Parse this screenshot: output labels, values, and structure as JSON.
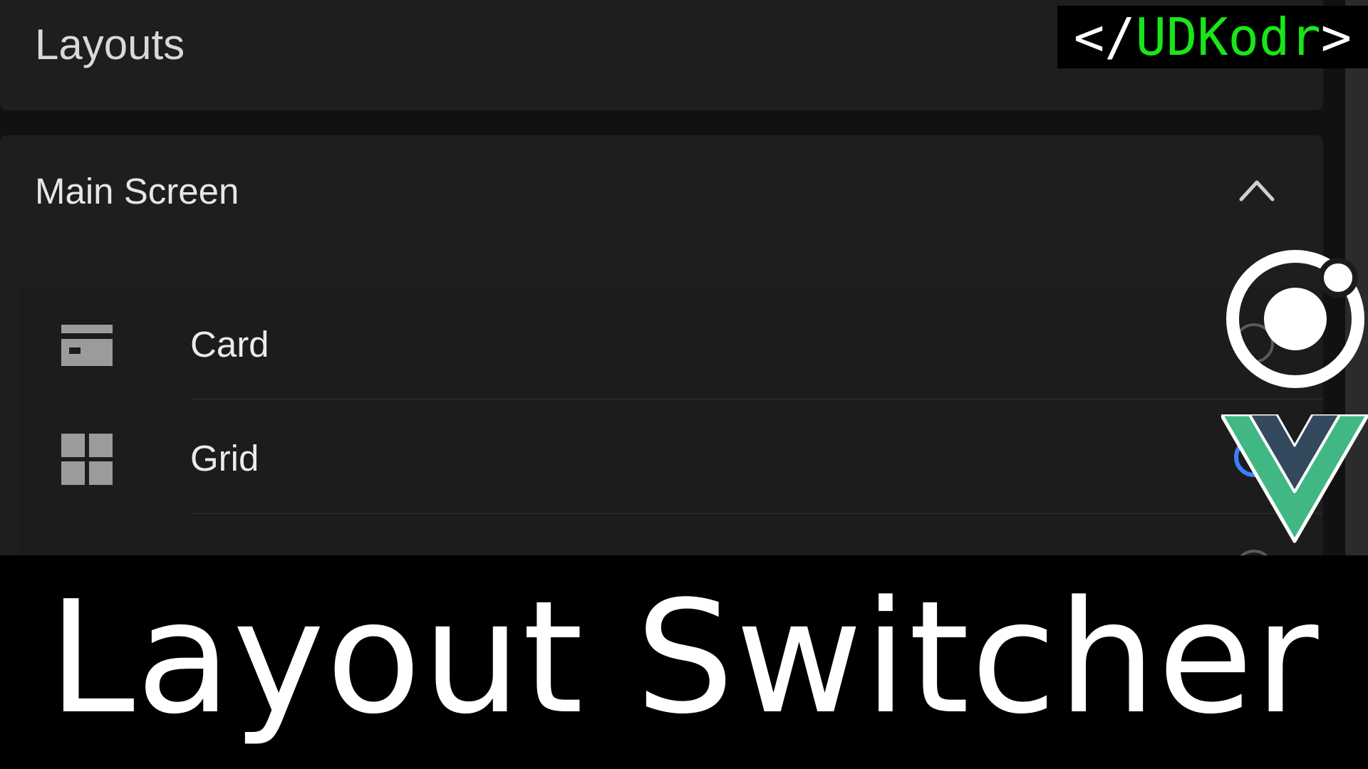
{
  "header": {
    "title": "Layouts"
  },
  "section": {
    "title": "Main Screen",
    "expanded": true,
    "toggle_icon": "chevron-up-icon"
  },
  "options": [
    {
      "label": "Card",
      "icon": "card-icon",
      "selected": false
    },
    {
      "label": "Grid",
      "icon": "grid-icon",
      "selected": true
    }
  ],
  "banner": {
    "title": "Layout Switcher"
  },
  "brand": {
    "open": "</",
    "name": "UDKodr",
    "close": ">"
  },
  "colors": {
    "accent": "#3880ff",
    "brand_green": "#19e619",
    "vue_green": "#41b883",
    "vue_dark": "#35495e"
  }
}
